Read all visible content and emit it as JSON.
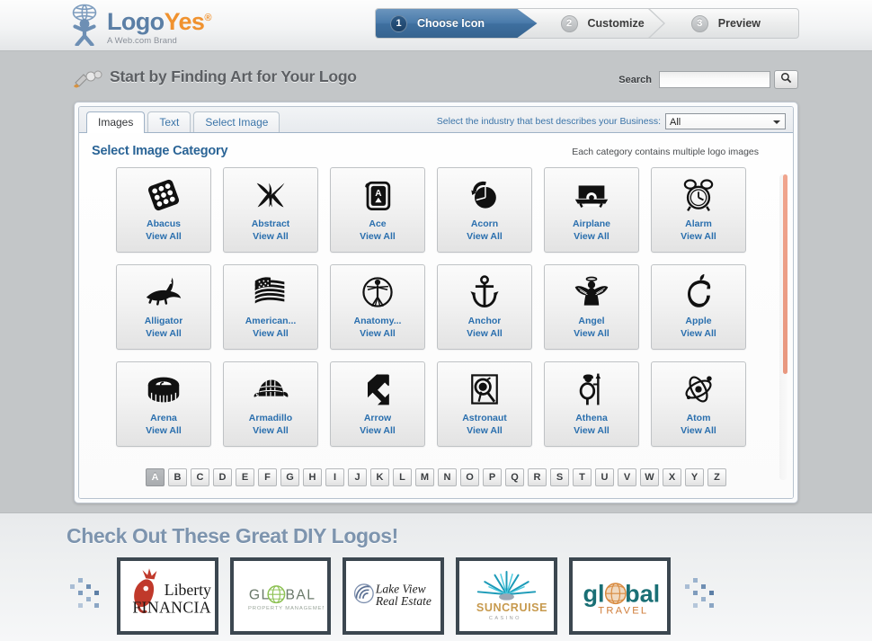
{
  "brand": {
    "name_part1": "Logo",
    "name_part2": "Yes",
    "registered": "®",
    "tagline": "A Web.com Brand",
    "logo_icon": "globe-person-icon"
  },
  "steps": [
    {
      "number": "1",
      "label": "Choose Icon",
      "state": "active"
    },
    {
      "number": "2",
      "label": "Customize",
      "state": "idle"
    },
    {
      "number": "3",
      "label": "Preview",
      "state": "idle"
    }
  ],
  "header": {
    "title": "Start by Finding Art for Your Logo",
    "title_icon": "paintbrush-icon",
    "search_label": "Search",
    "search_value": "",
    "search_placeholder": "",
    "search_button_icon": "magnifier-icon"
  },
  "panel": {
    "tabs": [
      {
        "label": "Images",
        "active": true
      },
      {
        "label": "Text",
        "active": false
      },
      {
        "label": "Select Image",
        "active": false
      }
    ],
    "industry": {
      "label": "Select the industry that best describes your Business:",
      "selected": "All",
      "options": [
        "All"
      ]
    },
    "section_title": "Select Image Category",
    "section_note": "Each category contains multiple logo images",
    "view_all_label": "View All",
    "categories": [
      {
        "name": "Abacus",
        "art": "abacus"
      },
      {
        "name": "Abstract",
        "art": "abstract"
      },
      {
        "name": "Ace",
        "art": "ace"
      },
      {
        "name": "Acorn",
        "art": "acorn"
      },
      {
        "name": "Airplane",
        "art": "airplane"
      },
      {
        "name": "Alarm",
        "art": "alarm"
      },
      {
        "name": "Alligator",
        "art": "alligator"
      },
      {
        "name": "American...",
        "art": "american-flag"
      },
      {
        "name": "Anatomy...",
        "art": "anatomy"
      },
      {
        "name": "Anchor",
        "art": "anchor"
      },
      {
        "name": "Angel",
        "art": "angel"
      },
      {
        "name": "Apple",
        "art": "apple"
      },
      {
        "name": "Arena",
        "art": "arena"
      },
      {
        "name": "Armadillo",
        "art": "armadillo"
      },
      {
        "name": "Arrow",
        "art": "arrow"
      },
      {
        "name": "Astronaut",
        "art": "astronaut"
      },
      {
        "name": "Athena",
        "art": "athena"
      },
      {
        "name": "Atom",
        "art": "atom"
      }
    ],
    "alphabet": [
      "A",
      "B",
      "C",
      "D",
      "E",
      "F",
      "G",
      "H",
      "I",
      "J",
      "K",
      "L",
      "M",
      "N",
      "O",
      "P",
      "Q",
      "R",
      "S",
      "T",
      "U",
      "V",
      "W",
      "X",
      "Y",
      "Z"
    ],
    "alphabet_active": "A"
  },
  "footer": {
    "title": "Check Out These Great DIY Logos!",
    "logos": [
      {
        "id": "liberty-financial",
        "line1": "Liberty",
        "line2": "FINANCIAL"
      },
      {
        "id": "global-property-management",
        "line1": "GL    BAL",
        "line2": "PROPERTY MANAGEMENT"
      },
      {
        "id": "lake-view-real-estate",
        "line1": "Lake View",
        "line2": "Real Estate"
      },
      {
        "id": "suncruise-casino",
        "line1": "SUNCRUISE",
        "line2": "C A S I N O"
      },
      {
        "id": "global-travel",
        "line1": "gl  bal",
        "line2": "TRAVEL"
      }
    ]
  },
  "colors": {
    "brand_blue": "#5b7fa6",
    "brand_orange": "#f0922f",
    "active_step": "#3e6f9f",
    "link_blue": "#2a6fae",
    "heading_blue": "#2a6496",
    "footer_title": "#7d94ae",
    "scrollbar_thumb": "#e8977f"
  }
}
